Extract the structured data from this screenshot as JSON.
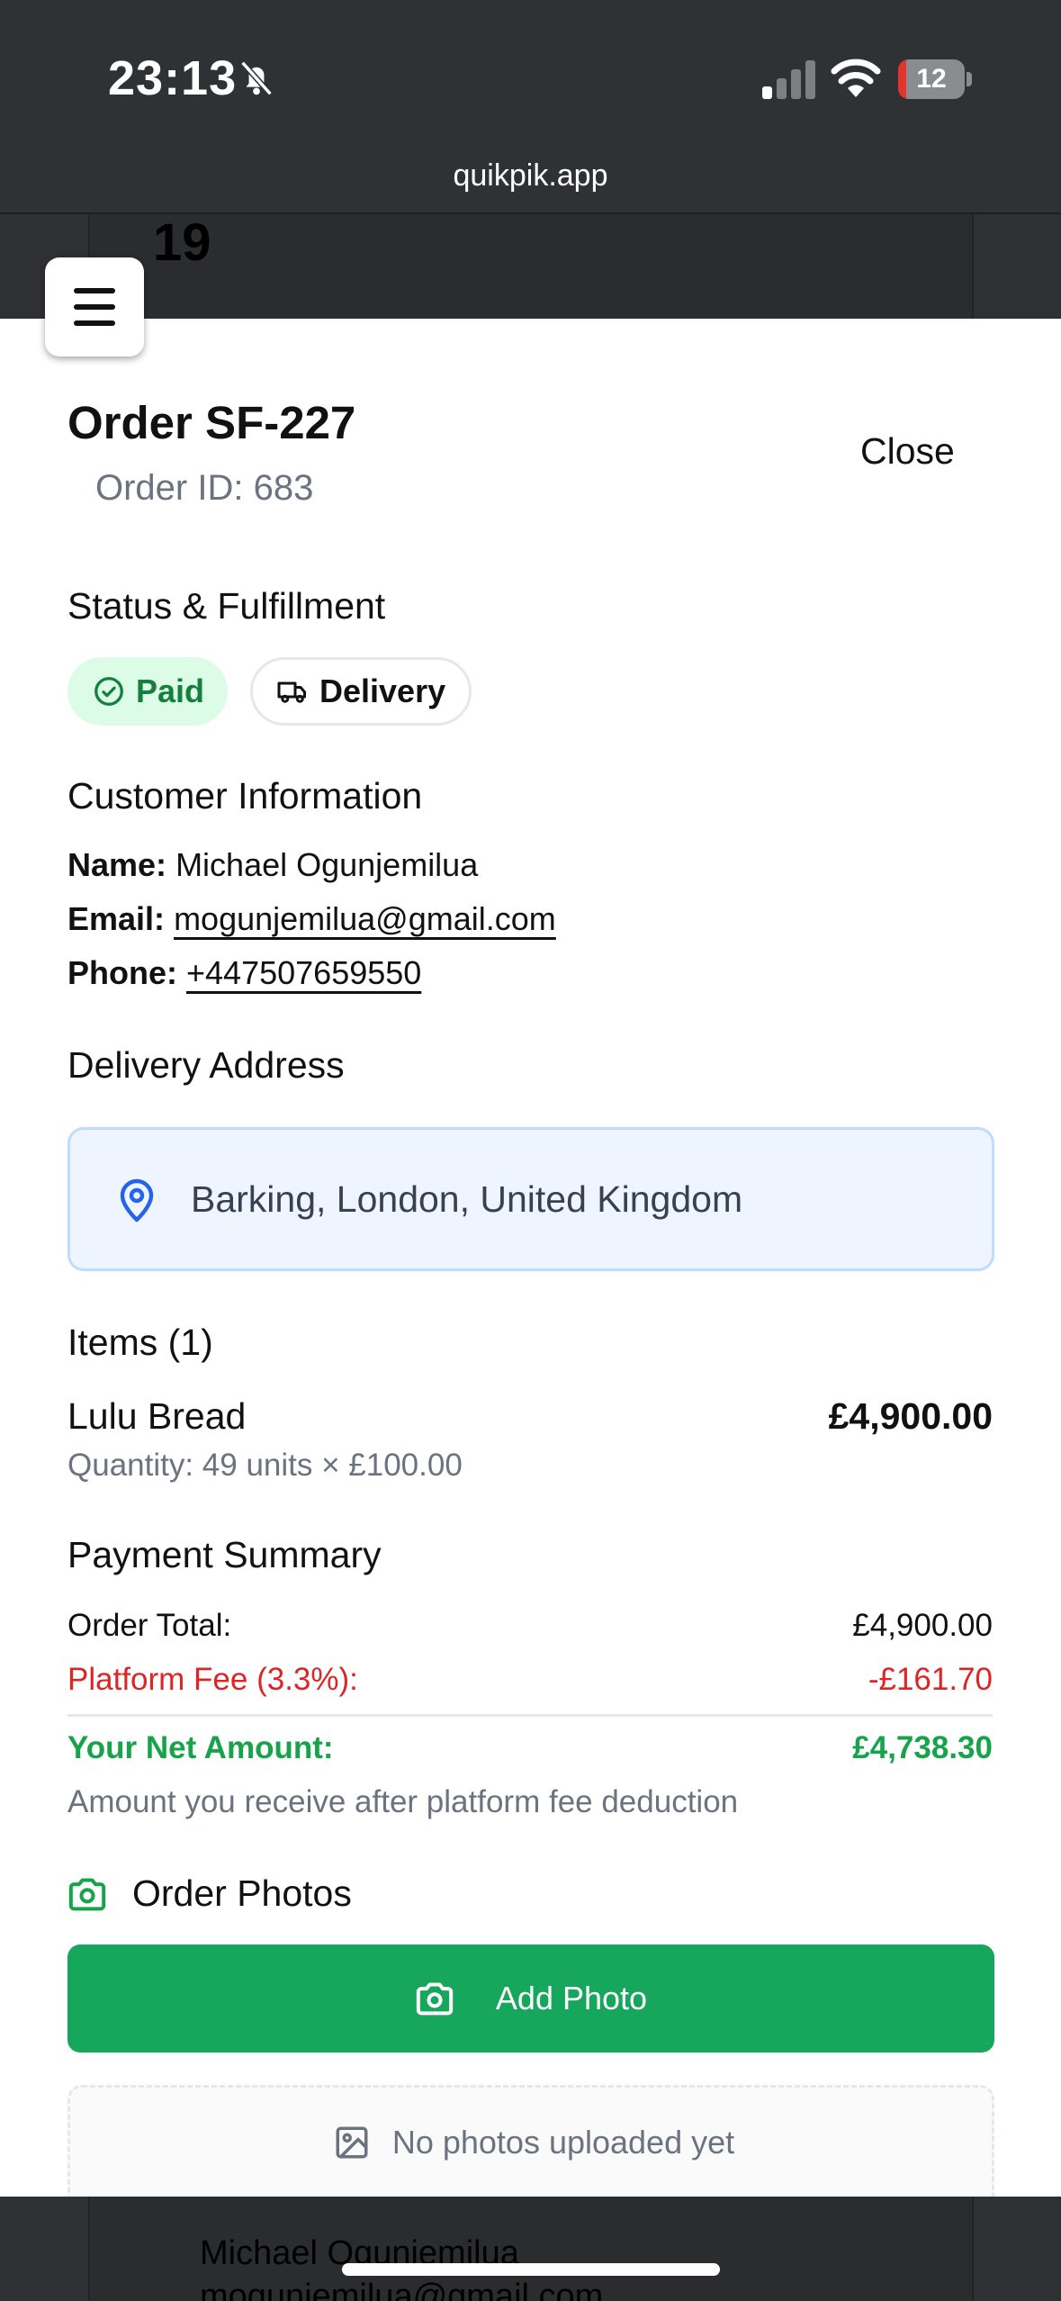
{
  "status_bar": {
    "time": "23:13",
    "battery": "12",
    "battery_percent": 12,
    "url": "quikpik.app",
    "icons": [
      "bell-slash-icon",
      "signal-icon",
      "wifi-icon",
      "battery-icon"
    ]
  },
  "background": {
    "number": "19",
    "customer_name": "Michael Ogunjemilua",
    "customer_email": "mogunjemilua@gmail.com"
  },
  "modal": {
    "title": "Order SF-227",
    "subtitle": "Order ID: 683",
    "close_label": "Close",
    "status": {
      "heading": "Status & Fulfillment",
      "paid_label": "Paid",
      "delivery_label": "Delivery"
    },
    "customer": {
      "heading": "Customer Information",
      "name_key": "Name:",
      "name": "Michael Ogunjemilua",
      "email_key": "Email:",
      "email": "mogunjemilua@gmail.com",
      "phone_key": "Phone:",
      "phone": "+447507659550"
    },
    "delivery": {
      "heading": "Delivery Address",
      "address": "Barking, London, United Kingdom"
    },
    "items": {
      "heading": "Items (1)",
      "list": [
        {
          "name": "Lulu Bread",
          "price": "£4,900.00",
          "quantity": "Quantity: 49 units × £100.00"
        }
      ]
    },
    "payment": {
      "heading": "Payment Summary",
      "total_label": "Order Total:",
      "total_value": "£4,900.00",
      "fee_label": "Platform Fee (3.3%):",
      "fee_value": "-£161.70",
      "net_label": "Your Net Amount:",
      "net_value": "£4,738.30",
      "note": "Amount you receive after platform fee deduction"
    },
    "photos": {
      "heading": "Order Photos",
      "add_label": "Add Photo",
      "empty_label": "No photos uploaded yet"
    }
  },
  "colors": {
    "accent_green": "#16a65c",
    "paid_bg": "#dcfce7",
    "fee_red": "#dc2626",
    "address_bg": "#eef5ff",
    "address_pin": "#2563eb"
  }
}
